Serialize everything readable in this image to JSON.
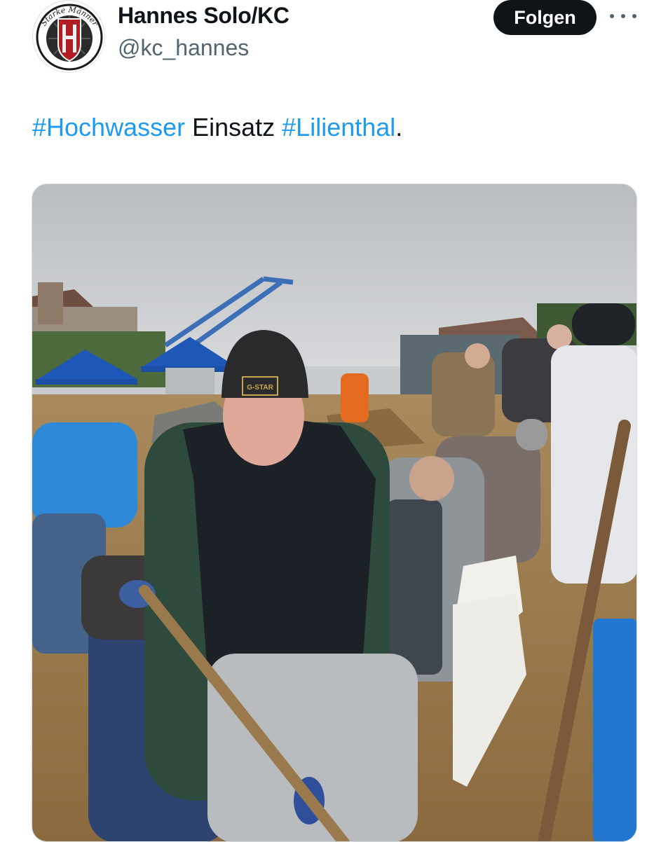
{
  "author": {
    "display_name": "Hannes Solo/KC",
    "handle": "@kc_hannes",
    "avatar_text": "Starke Männer",
    "avatar_icon": "shield-logo-icon"
  },
  "actions": {
    "follow_label": "Folgen",
    "more_icon": "more-dots-icon"
  },
  "tweet": {
    "parts": [
      "#Hochwasser",
      " Einsatz ",
      "#Lilienthal",
      "."
    ]
  },
  "media": {
    "beanie_label": "G-STAR"
  },
  "colors": {
    "hashtag": "#1d9bf0",
    "follow_bg": "#0f1419",
    "secondary_text": "#536471"
  }
}
